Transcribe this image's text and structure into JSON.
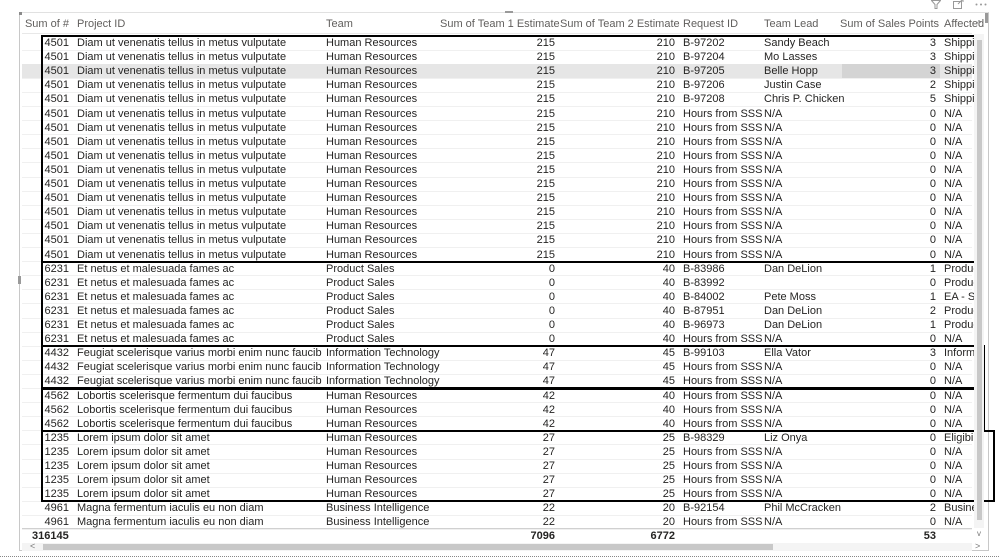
{
  "visual_header_icons": [
    "filter-icon",
    "focus-mode-icon",
    "more-options-icon"
  ],
  "columns": [
    {
      "key": "sum_num",
      "label": "Sum of #"
    },
    {
      "key": "project",
      "label": "Project ID"
    },
    {
      "key": "team",
      "label": "Team"
    },
    {
      "key": "t1",
      "label": "Sum of Team 1 Estimate"
    },
    {
      "key": "t2",
      "label": "Sum of Team 2 Estimate"
    },
    {
      "key": "req",
      "label": "Request ID"
    },
    {
      "key": "lead",
      "label": "Team Lead"
    },
    {
      "key": "sales",
      "label": "Sum of Sales Points"
    },
    {
      "key": "affected",
      "label": "Affected"
    }
  ],
  "sort_indicator": "^",
  "rows": [
    [
      "4501",
      "Diam ut venenatis tellus in metus vulputate",
      "Human Resources",
      "215",
      "210",
      "B-97202",
      "Sandy Beach",
      "3",
      "Shipping"
    ],
    [
      "4501",
      "Diam ut venenatis tellus in metus vulputate",
      "Human Resources",
      "215",
      "210",
      "B-97204",
      "Mo Lasses",
      "3",
      "Shipping"
    ],
    [
      "4501",
      "Diam ut venenatis tellus in metus vulputate",
      "Human Resources",
      "215",
      "210",
      "B-97205",
      "Belle Hopp",
      "3",
      "Shipping"
    ],
    [
      "4501",
      "Diam ut venenatis tellus in metus vulputate",
      "Human Resources",
      "215",
      "210",
      "B-97206",
      "Justin Case",
      "2",
      "Shipping"
    ],
    [
      "4501",
      "Diam ut venenatis tellus in metus vulputate",
      "Human Resources",
      "215",
      "210",
      "B-97208",
      "Chris P. Chicken",
      "5",
      "Shipping"
    ],
    [
      "4501",
      "Diam ut venenatis tellus in metus vulputate",
      "Human Resources",
      "215",
      "210",
      "Hours from SSS",
      "N/A",
      "0",
      "N/A"
    ],
    [
      "4501",
      "Diam ut venenatis tellus in metus vulputate",
      "Human Resources",
      "215",
      "210",
      "Hours from SSS",
      "N/A",
      "0",
      "N/A"
    ],
    [
      "4501",
      "Diam ut venenatis tellus in metus vulputate",
      "Human Resources",
      "215",
      "210",
      "Hours from SSS",
      "N/A",
      "0",
      "N/A"
    ],
    [
      "4501",
      "Diam ut venenatis tellus in metus vulputate",
      "Human Resources",
      "215",
      "210",
      "Hours from SSS",
      "N/A",
      "0",
      "N/A"
    ],
    [
      "4501",
      "Diam ut venenatis tellus in metus vulputate",
      "Human Resources",
      "215",
      "210",
      "Hours from SSS",
      "N/A",
      "0",
      "N/A"
    ],
    [
      "4501",
      "Diam ut venenatis tellus in metus vulputate",
      "Human Resources",
      "215",
      "210",
      "Hours from SSS",
      "N/A",
      "0",
      "N/A"
    ],
    [
      "4501",
      "Diam ut venenatis tellus in metus vulputate",
      "Human Resources",
      "215",
      "210",
      "Hours from SSS",
      "N/A",
      "0",
      "N/A"
    ],
    [
      "4501",
      "Diam ut venenatis tellus in metus vulputate",
      "Human Resources",
      "215",
      "210",
      "Hours from SSS",
      "N/A",
      "0",
      "N/A"
    ],
    [
      "4501",
      "Diam ut venenatis tellus in metus vulputate",
      "Human Resources",
      "215",
      "210",
      "Hours from SSS",
      "N/A",
      "0",
      "N/A"
    ],
    [
      "4501",
      "Diam ut venenatis tellus in metus vulputate",
      "Human Resources",
      "215",
      "210",
      "Hours from SSS",
      "N/A",
      "0",
      "N/A"
    ],
    [
      "4501",
      "Diam ut venenatis tellus in metus vulputate",
      "Human Resources",
      "215",
      "210",
      "Hours from SSS",
      "N/A",
      "0",
      "N/A"
    ],
    [
      "6231",
      "Et netus et malesuada fames ac",
      "Product Sales",
      "0",
      "40",
      "B-83986",
      "Dan DeLion",
      "1",
      "Product"
    ],
    [
      "6231",
      "Et netus et malesuada fames ac",
      "Product Sales",
      "0",
      "40",
      "B-83992",
      "",
      "0",
      "Product"
    ],
    [
      "6231",
      "Et netus et malesuada fames ac",
      "Product Sales",
      "0",
      "40",
      "B-84002",
      "Pete Moss",
      "1",
      "EA - Solu"
    ],
    [
      "6231",
      "Et netus et malesuada fames ac",
      "Product Sales",
      "0",
      "40",
      "B-87951",
      "Dan DeLion",
      "2",
      "Product"
    ],
    [
      "6231",
      "Et netus et malesuada fames ac",
      "Product Sales",
      "0",
      "40",
      "B-96973",
      "Dan DeLion",
      "1",
      "Product"
    ],
    [
      "6231",
      "Et netus et malesuada fames ac",
      "Product Sales",
      "0",
      "40",
      "Hours from SSS",
      "N/A",
      "0",
      "N/A"
    ],
    [
      "4432",
      "Feugiat scelerisque varius morbi enim nunc faucibus",
      "Information Technology",
      "47",
      "45",
      "B-99103",
      "Ella Vator",
      "3",
      "Informat"
    ],
    [
      "4432",
      "Feugiat scelerisque varius morbi enim nunc faucibus",
      "Information Technology",
      "47",
      "45",
      "Hours from SSS",
      "N/A",
      "0",
      "N/A"
    ],
    [
      "4432",
      "Feugiat scelerisque varius morbi enim nunc faucibus",
      "Information Technology",
      "47",
      "45",
      "Hours from SSS",
      "N/A",
      "0",
      "N/A"
    ],
    [
      "4562",
      "Lobortis scelerisque fermentum dui faucibus",
      "Human Resources",
      "42",
      "40",
      "Hours from SSS",
      "N/A",
      "0",
      "N/A"
    ],
    [
      "4562",
      "Lobortis scelerisque fermentum dui faucibus",
      "Human Resources",
      "42",
      "40",
      "Hours from SSS",
      "N/A",
      "0",
      "N/A"
    ],
    [
      "4562",
      "Lobortis scelerisque fermentum dui faucibus",
      "Human Resources",
      "42",
      "40",
      "Hours from SSS",
      "N/A",
      "0",
      "N/A"
    ],
    [
      "1235",
      "Lorem ipsum dolor sit amet",
      "Human Resources",
      "27",
      "25",
      "B-98329",
      "Liz Onya",
      "0",
      "Eligibility"
    ],
    [
      "1235",
      "Lorem ipsum dolor sit amet",
      "Human Resources",
      "27",
      "25",
      "Hours from SSS",
      "N/A",
      "0",
      "N/A"
    ],
    [
      "1235",
      "Lorem ipsum dolor sit amet",
      "Human Resources",
      "27",
      "25",
      "Hours from SSS",
      "N/A",
      "0",
      "N/A"
    ],
    [
      "1235",
      "Lorem ipsum dolor sit amet",
      "Human Resources",
      "27",
      "25",
      "Hours from SSS",
      "N/A",
      "0",
      "N/A"
    ],
    [
      "1235",
      "Lorem ipsum dolor sit amet",
      "Human Resources",
      "27",
      "25",
      "Hours from SSS",
      "N/A",
      "0",
      "N/A"
    ],
    [
      "4961",
      "Magna fermentum iaculis eu non diam",
      "Business Intelligence",
      "22",
      "20",
      "B-92154",
      "Phil McCracken",
      "2",
      "Business"
    ],
    [
      "4961",
      "Magna fermentum iaculis eu non diam",
      "Business Intelligence",
      "22",
      "20",
      "Hours from SSS",
      "N/A",
      "0",
      "N/A"
    ]
  ],
  "selected_row_index": 2,
  "highlight_groups": [
    {
      "label": "4501",
      "first_row": 0,
      "last_row": 15
    },
    {
      "label": "6231",
      "first_row": 16,
      "last_row": 21
    },
    {
      "label": "4432",
      "first_row": 22,
      "last_row": 24
    },
    {
      "label": "4562",
      "first_row": 25,
      "last_row": 27
    },
    {
      "label": "1235",
      "first_row": 28,
      "last_row": 32
    }
  ],
  "totals": {
    "sum_num": "316145",
    "t1": "7096",
    "t2": "6772",
    "sales": "53"
  },
  "scroll": {
    "up_arrow": "^",
    "down_arrow": "v",
    "left_arrow": "<",
    "right_arrow": ">"
  }
}
